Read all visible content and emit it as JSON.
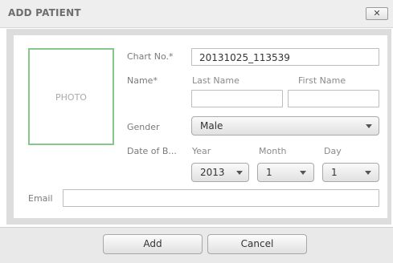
{
  "dialog": {
    "title": "ADD PATIENT",
    "close_glyph": "✕"
  },
  "photo": {
    "label": "PHOTO"
  },
  "chart_no": {
    "label": "Chart No.*",
    "value": "20131025_113539"
  },
  "name": {
    "label": "Name*",
    "last_name_label": "Last Name",
    "first_name_label": "First Name",
    "last_name_value": "",
    "first_name_value": ""
  },
  "gender": {
    "label": "Gender",
    "value": "Male"
  },
  "date_of_birth": {
    "label": "Date of B...",
    "year_label": "Year",
    "month_label": "Month",
    "day_label": "Day",
    "year_value": "2013",
    "month_value": "1",
    "day_value": "1"
  },
  "email": {
    "label": "Email",
    "value": ""
  },
  "buttons": {
    "add": "Add",
    "cancel": "Cancel"
  },
  "colors": {
    "photo_border": "#86c88a",
    "frame": "#dddddd",
    "footer": "#e9e9e9"
  },
  "icons": {
    "close": "close-icon",
    "dropdown": "chevron-down-icon"
  }
}
